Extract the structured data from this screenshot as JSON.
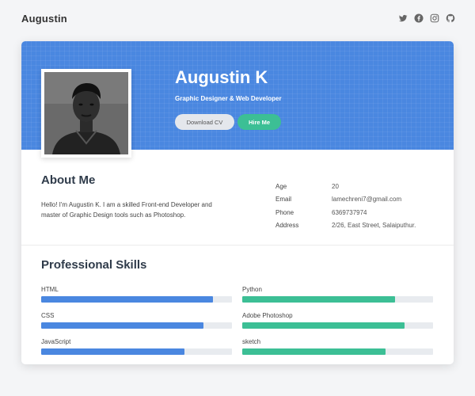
{
  "header": {
    "brand": "Augustin",
    "social_icons": [
      "twitter-icon",
      "facebook-icon",
      "instagram-icon",
      "github-icon"
    ]
  },
  "profile": {
    "name": "Augustin K",
    "role": "Graphic Designer & Web Developer",
    "download_cv_label": "Download CV",
    "hire_me_label": "Hire Me"
  },
  "about": {
    "title": "About Me",
    "text": "Hello! I'm Augustin K. I am a skilled Front-end Developer and master of Graphic Design tools such as Photoshop.",
    "info": [
      {
        "label": "Age",
        "value": "20"
      },
      {
        "label": "Email",
        "value": "lamechreni7@gmail.com"
      },
      {
        "label": "Phone",
        "value": "6369737974"
      },
      {
        "label": "Address",
        "value": "2/26, East Street, Salaiputhur."
      }
    ]
  },
  "skills": {
    "title": "Professional Skills",
    "items": [
      {
        "name": "HTML",
        "level": 0.9
      },
      {
        "name": "Python",
        "level": 0.8
      },
      {
        "name": "CSS",
        "level": 0.85
      },
      {
        "name": "Adobe Photoshop",
        "level": 0.85
      },
      {
        "name": "JavaScript",
        "level": 0.75
      },
      {
        "name": "sketch",
        "level": 0.75
      }
    ]
  },
  "colors": {
    "accent_blue": "#4a87e0",
    "accent_green": "#3cbf95"
  }
}
